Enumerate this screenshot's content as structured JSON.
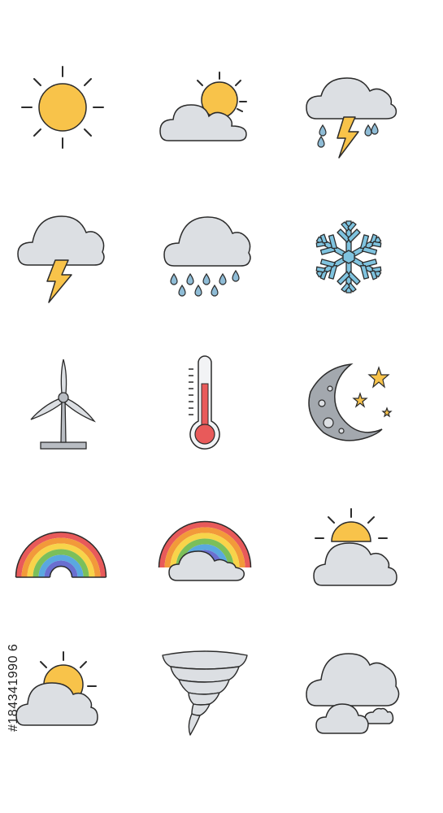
{
  "stock_id": "#184341990 6",
  "colors": {
    "sun": "#f8c34a",
    "cloud": "#dcdfe3",
    "outline": "#2b2b2b",
    "bolt": "#f8c34a",
    "rain": "#8fbcd6",
    "snow": "#7fc3df",
    "thermo_red": "#e85a5a",
    "moon": "#a3a8ae",
    "star": "#f8c34a",
    "tower": "#b8bcc2",
    "rainbow": [
      "#e85a5a",
      "#f29a3a",
      "#f8d44a",
      "#7bbf5a",
      "#5aa8e0",
      "#6a6fd0"
    ]
  },
  "icons": [
    {
      "name": "sun-icon"
    },
    {
      "name": "partly-cloudy-icon"
    },
    {
      "name": "thunderstorm-rain-icon"
    },
    {
      "name": "storm-cloud-icon"
    },
    {
      "name": "rain-cloud-icon"
    },
    {
      "name": "snowflake-icon"
    },
    {
      "name": "wind-turbine-icon"
    },
    {
      "name": "thermometer-icon"
    },
    {
      "name": "moon-stars-icon"
    },
    {
      "name": "rainbow-icon"
    },
    {
      "name": "rainbow-cloud-icon"
    },
    {
      "name": "sun-behind-cloud-icon"
    },
    {
      "name": "sun-cloud-icon"
    },
    {
      "name": "tornado-icon"
    },
    {
      "name": "overcast-clouds-icon"
    }
  ]
}
